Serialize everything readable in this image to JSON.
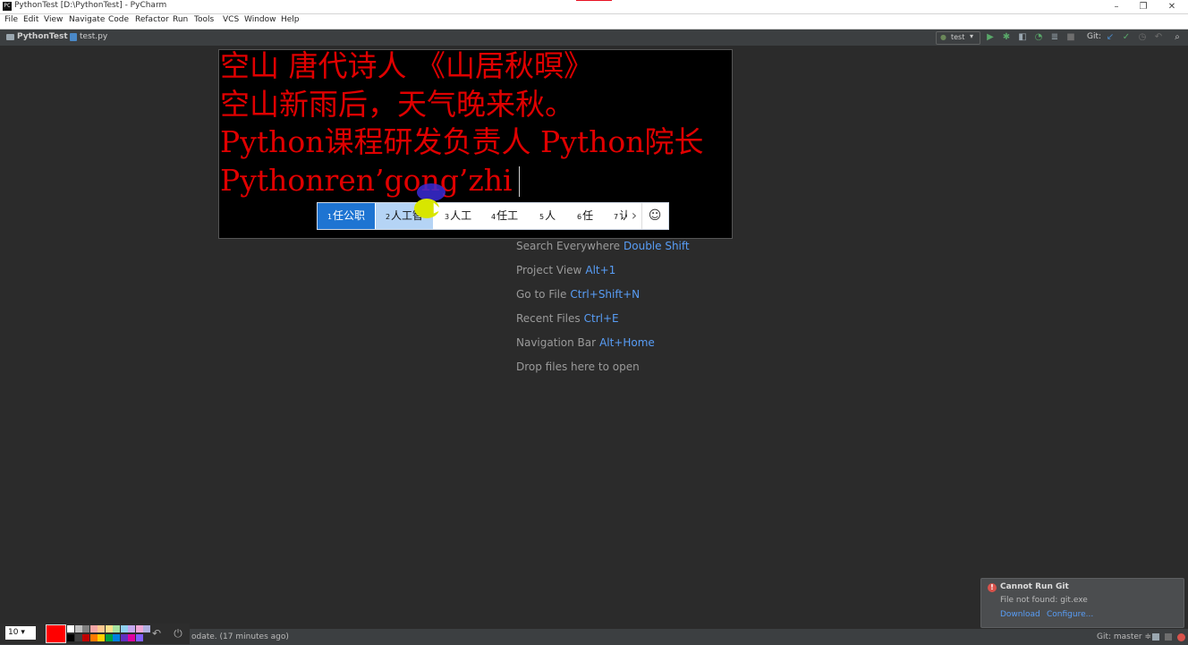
{
  "window": {
    "title": "PythonTest [D:\\PythonTest] - PyCharm",
    "controls": {
      "minimize": "–",
      "restore": "❐",
      "close": "✕"
    }
  },
  "menu": [
    "File",
    "Edit",
    "View",
    "Navigate",
    "Code",
    "Refactor",
    "Run",
    "Tools",
    "VCS",
    "Window",
    "Help"
  ],
  "breadcrumb": {
    "project": "PythonTest",
    "file": "test.py"
  },
  "toolbar": {
    "run_config": "test",
    "git_label": "Git:"
  },
  "editor": {
    "lines": [
      "空山 唐代诗人 《山居秋暝》",
      "空山新雨后，天气晚来秋。",
      "Python课程研发负责人 Python院长",
      "Pythonren’gong’zhi"
    ]
  },
  "ime": {
    "candidates": [
      {
        "num": "1",
        "text": "任公职"
      },
      {
        "num": "2",
        "text": "人工智"
      },
      {
        "num": "3",
        "text": "人工"
      },
      {
        "num": "4",
        "text": "任工"
      },
      {
        "num": "5",
        "text": "人"
      },
      {
        "num": "6",
        "text": "任"
      },
      {
        "num": "7",
        "text": "认"
      }
    ],
    "next": "›",
    "emoji": "☺"
  },
  "welcome_hints": [
    {
      "label": "Search Everywhere",
      "key": "Double Shift"
    },
    {
      "label": "Project View",
      "key": "Alt+1"
    },
    {
      "label": "Go to File",
      "key": "Ctrl+Shift+N"
    },
    {
      "label": "Recent Files",
      "key": "Ctrl+E"
    },
    {
      "label": "Navigation Bar",
      "key": "Alt+Home"
    },
    {
      "label": "Drop files here to open",
      "key": ""
    }
  ],
  "notification": {
    "title": "Cannot Run Git",
    "body": "File not found: git.exe",
    "links": [
      "Download",
      "Configure..."
    ]
  },
  "status": {
    "text": "odate. (17 minutes ago)",
    "git_branch": "Git: master ≑"
  },
  "drawing_toolbar": {
    "pen_size": "10 ▾",
    "current_color": "#ff0000",
    "colors": [
      "#ffffff",
      "#c0c0c0",
      "#808080",
      "#f4a7a7",
      "#ffc890",
      "#ffe08a",
      "#a6e3a1",
      "#8fd0f0",
      "#c5a8f0",
      "#f0a8d8",
      "#b0b0e0",
      "#000000",
      "#404040",
      "#c00000",
      "#ff7a00",
      "#ffd000",
      "#00a040",
      "#0080e0",
      "#6030c0",
      "#e000a0",
      "#8060ff"
    ]
  },
  "accent_colors": {
    "editor_text": "#e00000",
    "link": "#589df6",
    "ime_selected": "#1e74d2"
  }
}
